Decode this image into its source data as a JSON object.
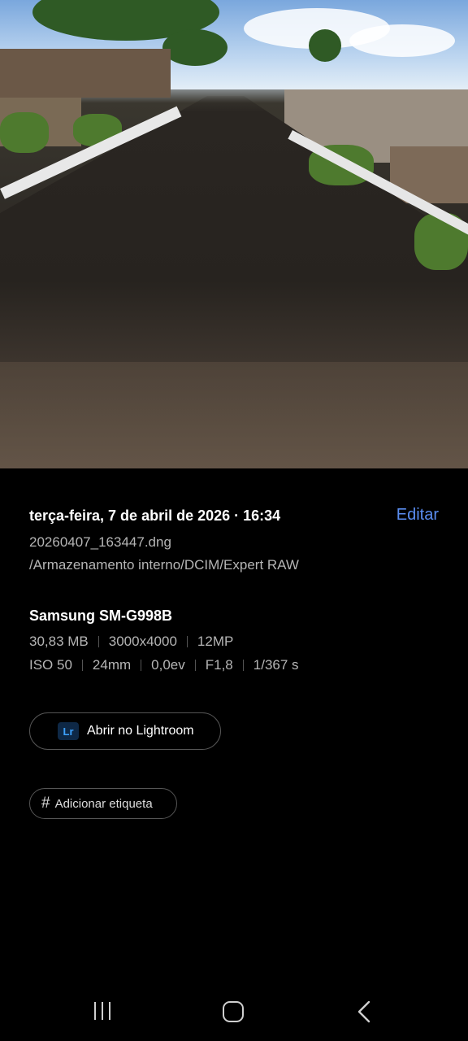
{
  "photo": {
    "description_icon": "photo-viewer-image"
  },
  "details": {
    "date_time": "terça-feira, 7 de abril de 2026 · 16:34",
    "edit_label": "Editar",
    "filename": "20260407_163447.dng",
    "path": "/Armazenamento interno/DCIM/Expert RAW",
    "device": "Samsung SM-G998B",
    "specs_row1": [
      "30,83 MB",
      "3000x4000",
      "12MP"
    ],
    "specs_row2": [
      "ISO 50",
      "24mm",
      "0,0ev",
      "F1,8",
      "1/367 s"
    ]
  },
  "actions": {
    "lightroom_icon_text": "Lr",
    "lightroom_label": "Abrir no Lightroom",
    "tag_icon": "#",
    "tag_label": "Adicionar etiqueta"
  },
  "colors": {
    "accent": "#5a8df0",
    "background": "#000000"
  }
}
